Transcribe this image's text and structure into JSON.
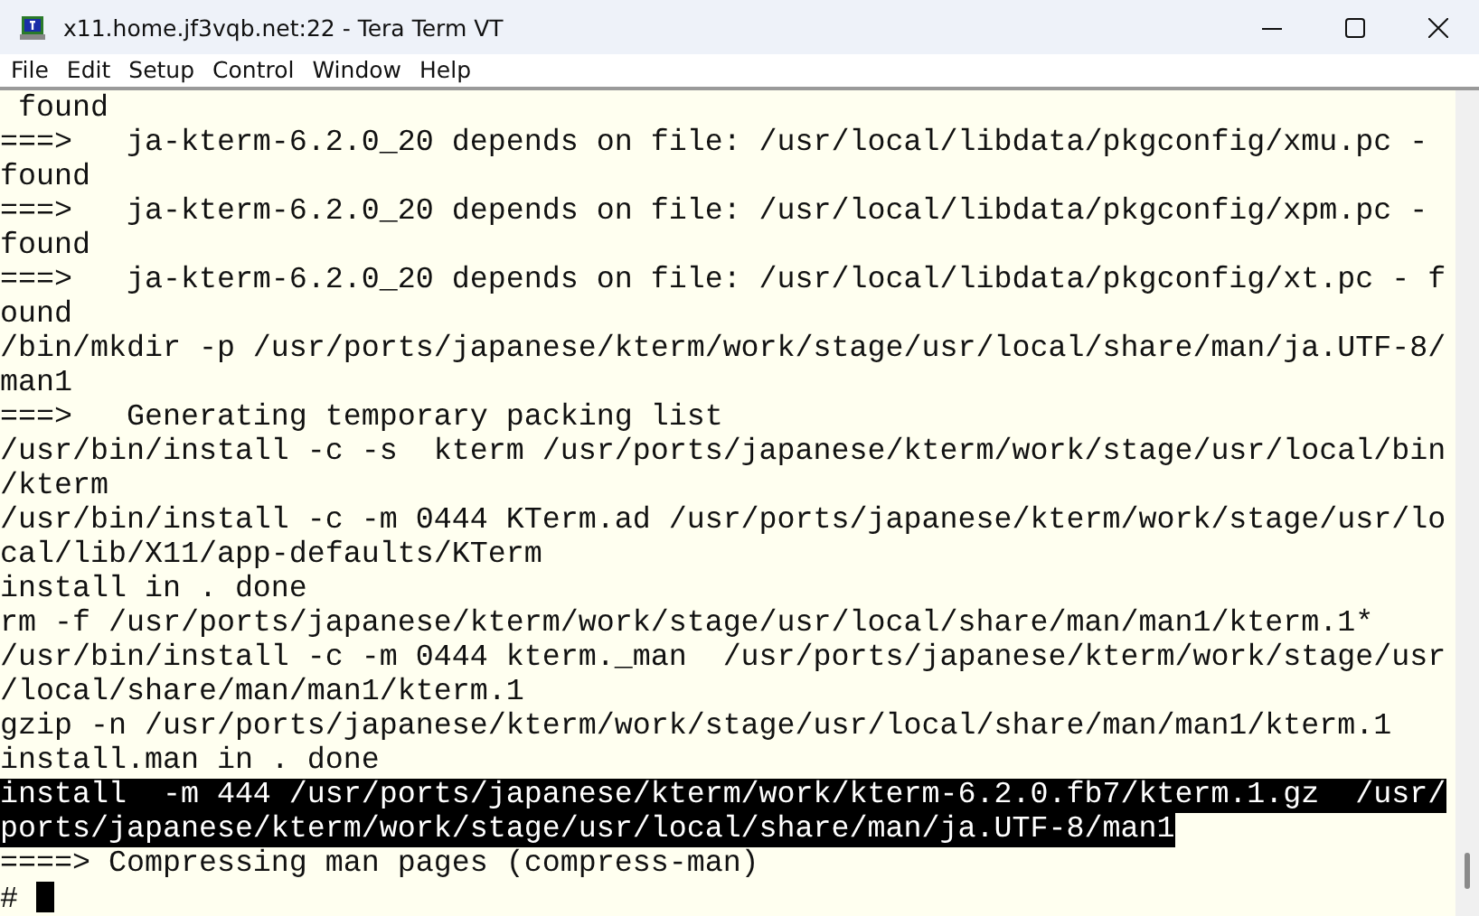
{
  "window": {
    "title": "x11.home.jf3vqb.net:22 - Tera Term VT"
  },
  "menu": [
    "File",
    "Edit",
    "Setup",
    "Control",
    "Window",
    "Help"
  ],
  "terminal": {
    "lines": [
      {
        "text": " found",
        "selected": false
      },
      {
        "text": "===>   ja-kterm-6.2.0_20 depends on file: /usr/local/libdata/pkgconfig/xmu.pc -",
        "selected": false
      },
      {
        "text": "found",
        "selected": false
      },
      {
        "text": "===>   ja-kterm-6.2.0_20 depends on file: /usr/local/libdata/pkgconfig/xpm.pc -",
        "selected": false
      },
      {
        "text": "found",
        "selected": false
      },
      {
        "text": "===>   ja-kterm-6.2.0_20 depends on file: /usr/local/libdata/pkgconfig/xt.pc - f",
        "selected": false
      },
      {
        "text": "ound",
        "selected": false
      },
      {
        "text": "/bin/mkdir -p /usr/ports/japanese/kterm/work/stage/usr/local/share/man/ja.UTF-8/",
        "selected": false
      },
      {
        "text": "man1",
        "selected": false
      },
      {
        "text": "===>   Generating temporary packing list",
        "selected": false
      },
      {
        "text": "/usr/bin/install -c -s  kterm /usr/ports/japanese/kterm/work/stage/usr/local/bin",
        "selected": false
      },
      {
        "text": "/kterm",
        "selected": false
      },
      {
        "text": "/usr/bin/install -c -m 0444 KTerm.ad /usr/ports/japanese/kterm/work/stage/usr/lo",
        "selected": false
      },
      {
        "text": "cal/lib/X11/app-defaults/KTerm",
        "selected": false
      },
      {
        "text": "install in . done",
        "selected": false
      },
      {
        "text": "rm -f /usr/ports/japanese/kterm/work/stage/usr/local/share/man/man1/kterm.1*",
        "selected": false
      },
      {
        "text": "/usr/bin/install -c -m 0444 kterm._man  /usr/ports/japanese/kterm/work/stage/usr",
        "selected": false
      },
      {
        "text": "/local/share/man/man1/kterm.1",
        "selected": false
      },
      {
        "text": "gzip -n /usr/ports/japanese/kterm/work/stage/usr/local/share/man/man1/kterm.1",
        "selected": false
      },
      {
        "text": "install.man in . done",
        "selected": false
      },
      {
        "text": "install  -m 444 /usr/ports/japanese/kterm/work/kterm-6.2.0.fb7/kterm.1.gz  /usr/",
        "selected": true
      },
      {
        "text": "ports/japanese/kterm/work/stage/usr/local/share/man/ja.UTF-8/man1",
        "selected": true
      },
      {
        "text": "====> Compressing man pages (compress-man)",
        "selected": false
      }
    ],
    "prompt": "#"
  }
}
